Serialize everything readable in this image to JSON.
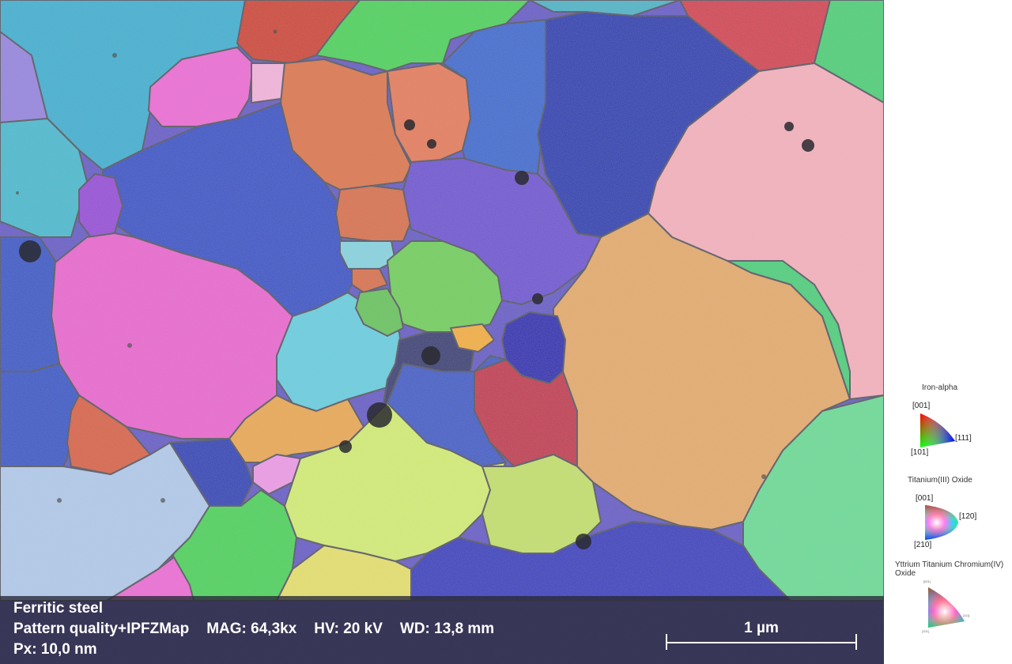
{
  "image": {
    "sample": "Ferritic steel",
    "mode": "Pattern quality+IPFZMap",
    "mag": "MAG: 64,3kx",
    "hv": "HV: 20 kV",
    "wd": "WD: 13,8 mm",
    "px": "Px: 10,0 nm",
    "scale_label": "1 µm"
  },
  "legend": {
    "phases": [
      {
        "name": "Iron-alpha",
        "labels": [
          "[001]",
          "[111]",
          "[101]"
        ]
      },
      {
        "name": "Titanium(III) Oxide",
        "labels": [
          "[001]",
          "[120]",
          "[210]"
        ]
      },
      {
        "name": "Yttrium Titanium Chromium(IV) Oxide",
        "labels": [
          "[001]",
          "[111]",
          "[101]"
        ]
      }
    ]
  },
  "colors": {
    "infobar_bg": "#282837",
    "grain_palette": [
      "#3fb2d2",
      "#c5e070",
      "#2b3fb3",
      "#ec6fd6",
      "#f4b3bf",
      "#e5ad70",
      "#4fd35f",
      "#dd6a49",
      "#7358d3",
      "#c23b52",
      "#8ad4e0"
    ]
  }
}
